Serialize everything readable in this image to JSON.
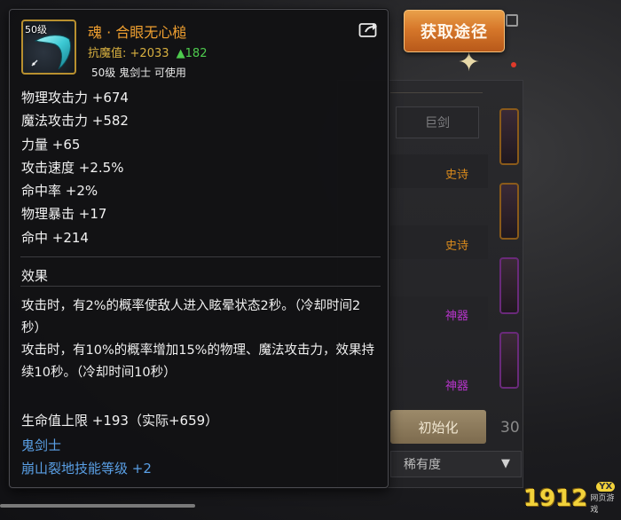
{
  "obtain_button": {
    "label": "获取途径"
  },
  "item": {
    "level_badge": "50级",
    "name": "魂 · 合眼无心槌",
    "resist_label": "抗魔值:",
    "resist_value": "+2033",
    "resist_gain": "▲182",
    "usable_text": "50级 鬼剑士 可使用"
  },
  "stats": [
    "物理攻击力 +674",
    "魔法攻击力 +582",
    "力量 +65",
    "攻击速度 +2.5%",
    "命中率 +2%",
    "物理暴击 +17",
    "命中 +214"
  ],
  "effect": {
    "title": "效果",
    "lines": [
      "攻击时，有2%的概率使敌人进入眩晕状态2秒。（冷却时间2秒）",
      "攻击时，有10%的概率增加15%的物理、魔法攻击力，效果持续10秒。（冷却时间10秒）"
    ]
  },
  "hp_bonus": "生命值上限 +193（实际+659）",
  "class_name": "鬼剑士",
  "skill_bonus": "崩山裂地技能等级 +2",
  "background": {
    "tab_label": "巨剑",
    "tags": [
      "史诗",
      "史诗",
      "神器",
      "神器"
    ],
    "reset_label": "初始化",
    "select_value": "稀有度",
    "side_number": "30"
  },
  "watermark": {
    "number": "1912",
    "badge": "YX",
    "sub": "网页游戏"
  },
  "icons": {
    "share": "share-icon",
    "sparkle": "sparkle-icon",
    "dropdown": "chevron-down-icon"
  },
  "colors": {
    "item_name": "#f0a030",
    "resist": "#d8b040",
    "gain": "#4ecb4e",
    "blue_text": "#5aa0e6",
    "obtain_button": "#d6772a",
    "epic": "#d98a1c",
    "myth": "#b434c8"
  }
}
